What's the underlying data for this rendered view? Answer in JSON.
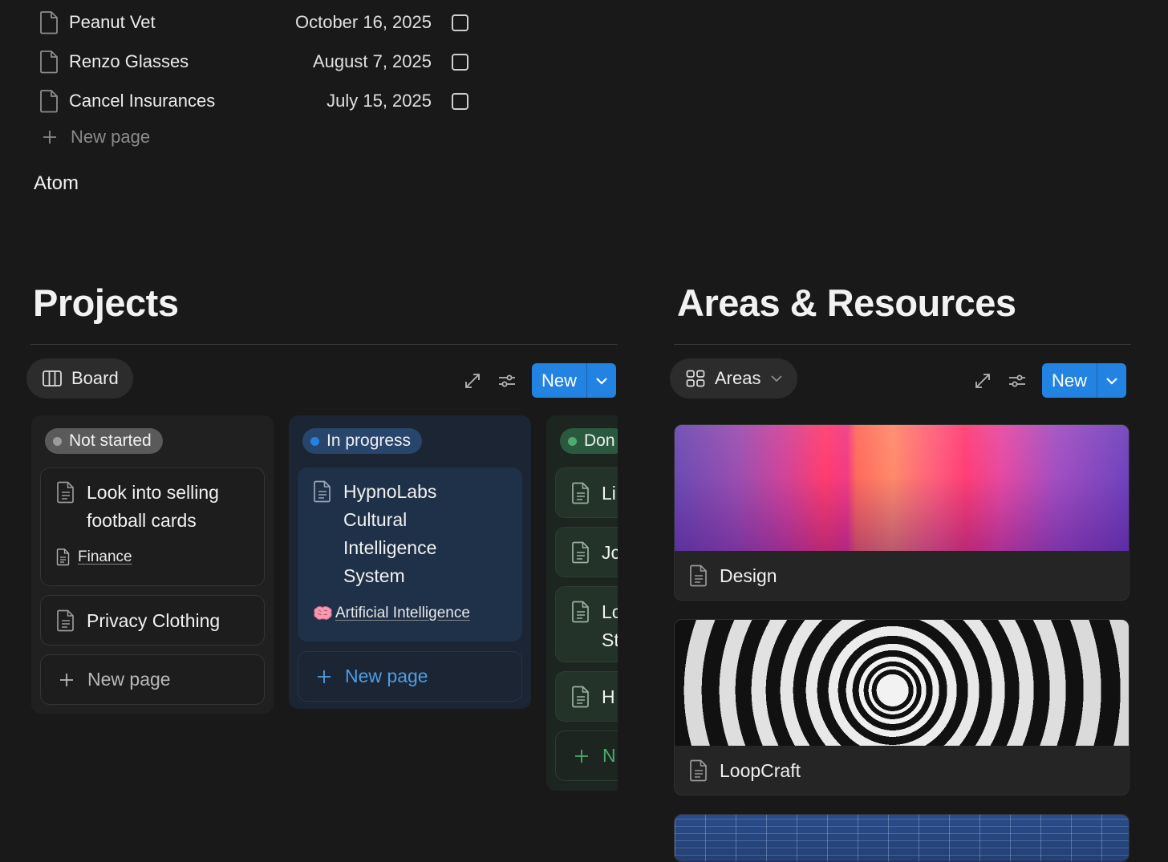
{
  "tasks": [
    {
      "title": "Peanut Vet",
      "date": "October 16, 2025"
    },
    {
      "title": "Renzo Glasses",
      "date": "August 7, 2025"
    },
    {
      "title": "Cancel Insurances",
      "date": "July 15, 2025"
    }
  ],
  "task_list": {
    "new_page": "New page"
  },
  "atom_label": "Atom",
  "projects": {
    "title": "Projects",
    "view_label": "Board",
    "new_label": "New",
    "columns": [
      {
        "status": "Not started",
        "cards": [
          {
            "title_lines": [
              "Look into selling",
              "football cards"
            ],
            "property": "Finance"
          },
          {
            "title_lines": [
              "Privacy Clothing"
            ]
          }
        ],
        "new_page": "New page"
      },
      {
        "status": "In progress",
        "cards": [
          {
            "title_lines": [
              "HypnoLabs",
              "Cultural",
              "Intelligence",
              "System"
            ],
            "property": "Artificial Intelligence",
            "property_icon": "brain-emoji"
          }
        ],
        "new_page": "New page"
      },
      {
        "status": "Don",
        "cards": [
          {
            "title_lines": [
              "Li"
            ]
          },
          {
            "title_lines": [
              "Jc"
            ]
          },
          {
            "title_lines": [
              "Lc",
              "St"
            ]
          },
          {
            "title_lines": [
              "H"
            ]
          }
        ],
        "new_page": "N"
      }
    ]
  },
  "areas": {
    "title": "Areas & Resources",
    "view_label": "Areas",
    "new_label": "New",
    "cards": [
      {
        "title": "Design",
        "cover": "gradient-abstract"
      },
      {
        "title": "LoopCraft",
        "cover": "concentric-rings"
      },
      {
        "title": "",
        "cover": "blueprint"
      }
    ]
  },
  "colors": {
    "background": "#191919",
    "accent": "#2383e2",
    "status_not_started": "#5a5a5a",
    "status_in_progress": "#28456c",
    "status_done": "#2b593f",
    "in_progress_text": "#529cca",
    "done_text": "#4dab6f"
  }
}
